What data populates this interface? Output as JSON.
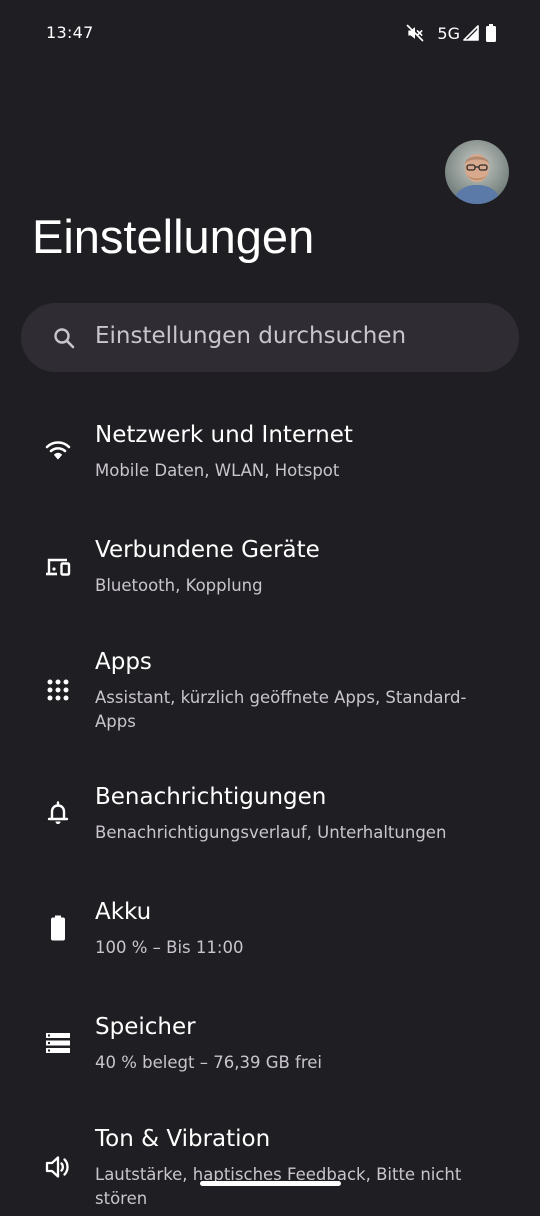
{
  "status_bar": {
    "time": "13:47",
    "network": "5G",
    "icons": [
      "mute-icon",
      "signal-icon",
      "battery-icon"
    ]
  },
  "header": {
    "title": "Einstellungen",
    "avatar": "user-avatar"
  },
  "search": {
    "placeholder": "Einstellungen durchsuchen",
    "icon": "search-icon"
  },
  "items": [
    {
      "title": "Netzwerk und Internet",
      "subtitle": "Mobile Daten, WLAN, Hotspot",
      "icon": "wifi-icon"
    },
    {
      "title": "Verbundene Geräte",
      "subtitle": "Bluetooth, Kopplung",
      "icon": "devices-icon"
    },
    {
      "title": "Apps",
      "subtitle": "Assistant, kürzlich geöffnete Apps, Standard-Apps",
      "icon": "apps-grid-icon"
    },
    {
      "title": "Benachrichtigungen",
      "subtitle": "Benachrichtigungsverlauf, Unterhaltungen",
      "icon": "bell-icon"
    },
    {
      "title": "Akku",
      "subtitle": "100 % – Bis 11:00",
      "icon": "battery-icon"
    },
    {
      "title": "Speicher",
      "subtitle": "40 % belegt – 76,39 GB frei",
      "icon": "storage-icon"
    },
    {
      "title": "Ton & Vibration",
      "subtitle": "Lautstärke, haptisches Feedback, Bitte nicht stören",
      "icon": "volume-icon"
    }
  ],
  "colors": {
    "background": "#1f1e22",
    "search_background": "#2f2d33",
    "text_primary": "#ffffff",
    "text_secondary": "#c9c5cd"
  }
}
